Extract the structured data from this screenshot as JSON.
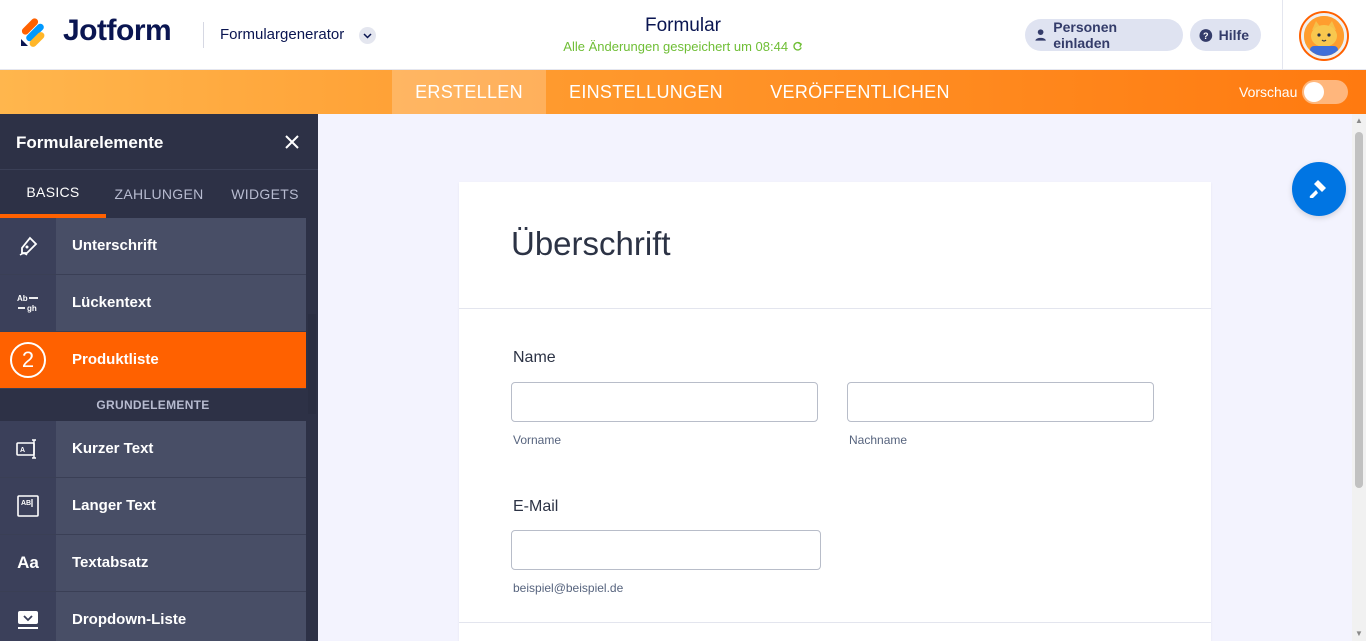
{
  "header": {
    "brand": "Jotform",
    "builder_menu": "Formulargenerator",
    "form_title": "Formular",
    "save_status": "Alle Änderungen gespeichert um 08:44",
    "invite_label": "Personen einladen",
    "help_label": "Hilfe"
  },
  "nav": {
    "tabs": [
      {
        "label": "ERSTELLEN",
        "active": true
      },
      {
        "label": "EINSTELLUNGEN",
        "active": false
      },
      {
        "label": "VERÖFFENTLICHEN",
        "active": false
      }
    ],
    "preview_label": "Vorschau",
    "preview_on": false
  },
  "sidebar": {
    "title": "Formularelemente",
    "tabs": [
      {
        "label": "BASICS",
        "active": true
      },
      {
        "label": "ZAHLUNGEN",
        "active": false
      },
      {
        "label": "WIDGETS",
        "active": false
      }
    ],
    "items_top": [
      {
        "label": "Unterschrift",
        "icon": "pen-signature-icon"
      },
      {
        "label": "Lückentext",
        "icon": "fill-blank-icon"
      },
      {
        "label": "Produktliste",
        "icon": "number-two-icon",
        "badge": "2",
        "active": true
      }
    ],
    "section_label": "GRUNDELEMENTE",
    "items_bottom": [
      {
        "label": "Kurzer Text",
        "icon": "short-text-icon"
      },
      {
        "label": "Langer Text",
        "icon": "long-text-icon"
      },
      {
        "label": "Textabsatz",
        "icon": "paragraph-icon",
        "glyph": "Aa"
      },
      {
        "label": "Dropdown-Liste",
        "icon": "dropdown-icon"
      }
    ]
  },
  "form": {
    "heading": "Überschrift",
    "name_label": "Name",
    "first_sublabel": "Vorname",
    "last_sublabel": "Nachname",
    "email_label": "E-Mail",
    "email_sublabel": "beispiel@beispiel.de",
    "first_value": "",
    "last_value": "",
    "email_value": ""
  },
  "colors": {
    "accent": "#ff6100",
    "navy": "#0a1551",
    "saved_green": "#6fbe35",
    "fab_blue": "#0075e3"
  }
}
